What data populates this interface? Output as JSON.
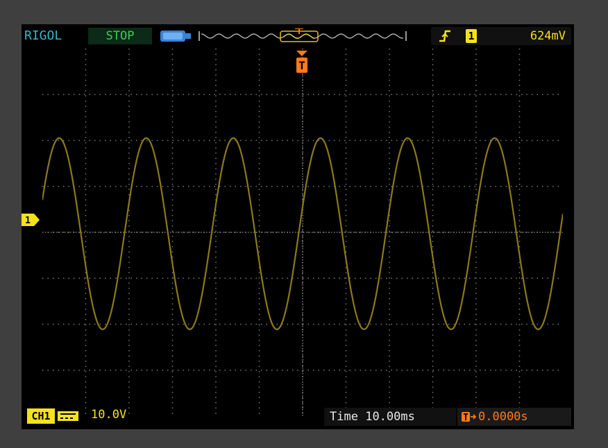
{
  "header": {
    "brand": "RIGOL",
    "run_state": "STOP"
  },
  "trigger": {
    "source": "1",
    "level": "624mV",
    "position_marker": "T"
  },
  "channel1": {
    "label": "CH1",
    "marker": "1",
    "scale": "10.0V"
  },
  "timebase": {
    "label": "Time",
    "value": "10.00ms",
    "delay": "0.0000s"
  },
  "colors": {
    "background": "#3f3f3f",
    "screen": "#000000",
    "trace": "#8c7a1a",
    "brand": "#35b7c6",
    "run_state": "#35d15a",
    "channel": "#f6e21b",
    "trigger": "#ff7a1a"
  }
}
